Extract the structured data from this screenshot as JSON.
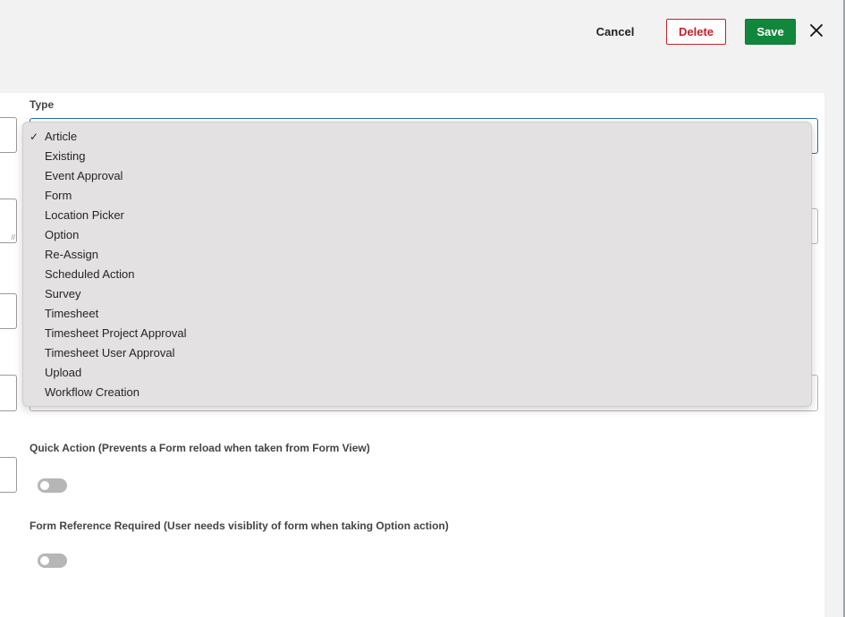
{
  "header": {
    "cancel_label": "Cancel",
    "delete_label": "Delete",
    "save_label": "Save",
    "close_icon": "close-icon"
  },
  "colors": {
    "save": "#11873c",
    "delete": "#c8202b",
    "focus_border": "#2f6f9f"
  },
  "form": {
    "type_label": "Type",
    "type_selected": "Article",
    "type_options": [
      "Article",
      "Existing",
      "Event Approval",
      "Form",
      "Location Picker",
      "Option",
      "Re-Assign",
      "Scheduled Action",
      "Survey",
      "Timesheet",
      "Timesheet Project Approval",
      "Timesheet User Approval",
      "Upload",
      "Workflow Creation"
    ],
    "quick_action_label": "Quick Action (Prevents a Form reload when taken from Form View)",
    "quick_action_on": false,
    "form_reference_label": "Form Reference Required (User needs visiblity of form when taking Option action)",
    "form_reference_on": false
  }
}
